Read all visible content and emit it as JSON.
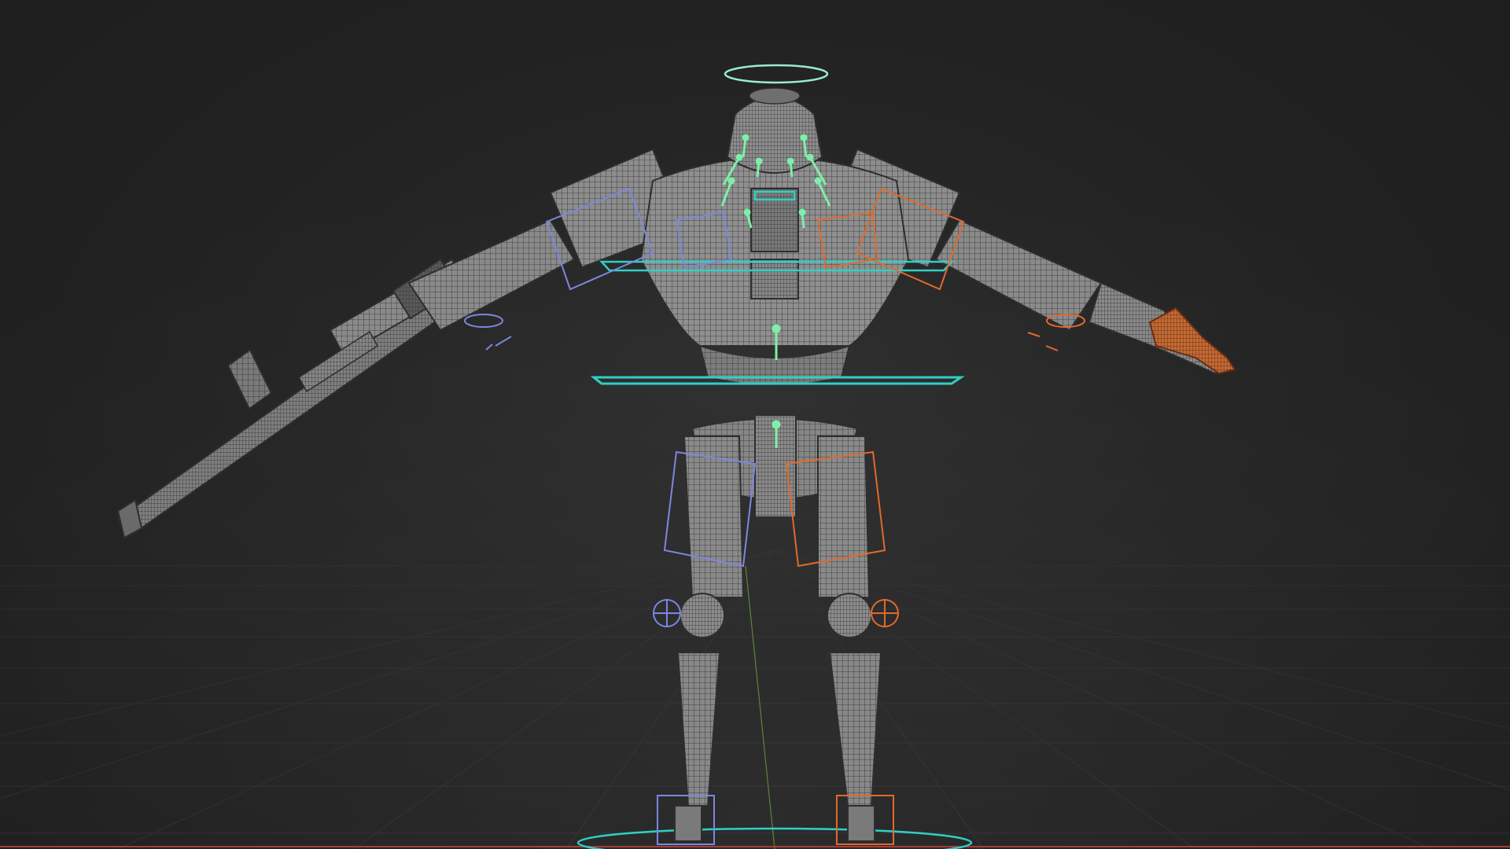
{
  "viewport": {
    "background": "#2f2f2f",
    "grid_color": "#3c3c3c",
    "x_axis_color": "#b3403a",
    "y_axis_color": "#6b9a3a"
  },
  "rig": {
    "mesh_color": "#9a9a9a",
    "mesh_dark": "#444444",
    "left_side_color": "#7d86e0",
    "right_side_color": "#e06a2c",
    "center_control_color": "#2fd0c4",
    "face_bone_color": "#7cf0a8"
  },
  "icons": {
    "head_halo": "halo-control-icon",
    "knee_pole": "pole-target-icon"
  }
}
